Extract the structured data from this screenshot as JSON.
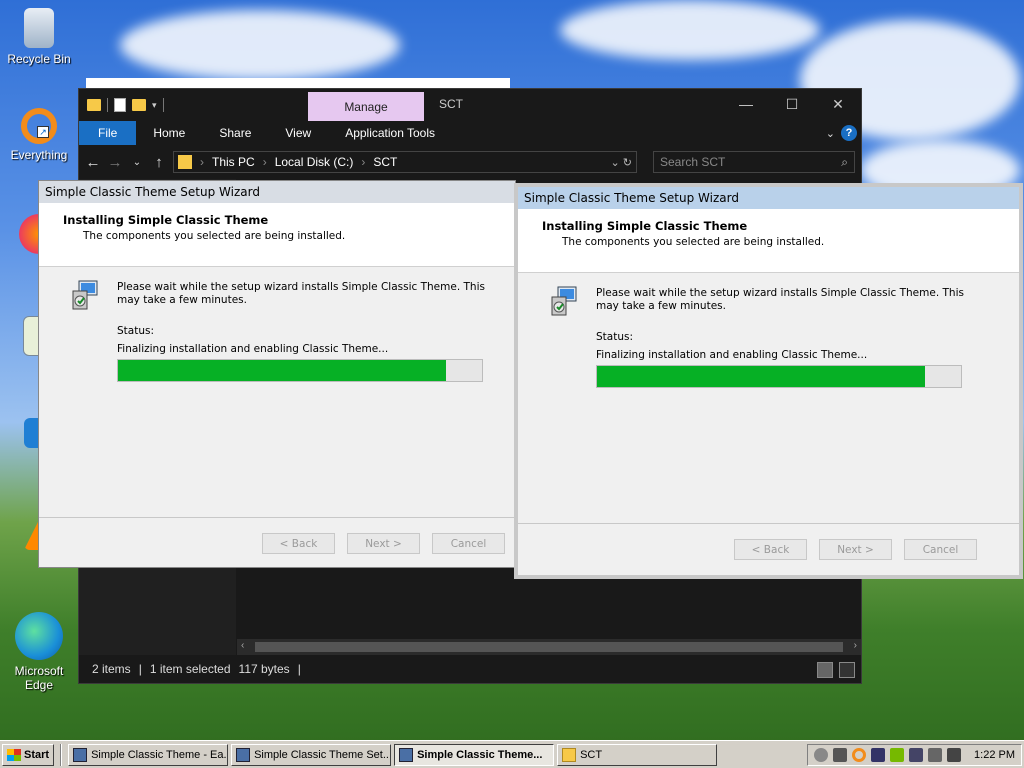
{
  "desktop": {
    "icons": [
      {
        "label": "Recycle Bin"
      },
      {
        "label": "Everything"
      },
      {
        "label": "Firefox"
      },
      {
        "label": "Notepad++"
      },
      {
        "label": "Visual Studio Code"
      },
      {
        "label": "VLC media player"
      },
      {
        "label": "Microsoft Edge"
      }
    ]
  },
  "explorer": {
    "manage_tab": "Manage",
    "title": "SCT",
    "ribbon_tabs": [
      "File",
      "Home",
      "Share",
      "View",
      "Application Tools"
    ],
    "address": [
      "This PC",
      "Local Disk (C:)",
      "SCT"
    ],
    "search_placeholder": "Search SCT",
    "status": {
      "items": "2 items",
      "selected": "1 item selected",
      "size": "117 bytes"
    }
  },
  "wizard_left": {
    "title": "Simple Classic Theme Setup Wizard",
    "heading": "Installing Simple Classic Theme",
    "subheading": "The components you selected are being installed.",
    "message": "Please wait while the setup wizard installs Simple Classic Theme. This may take a few minutes.",
    "status_label": "Status:",
    "status_text": "Finalizing installation and enabling Classic Theme...",
    "progress": 0.9,
    "buttons": {
      "back": "< Back",
      "next": "Next >",
      "cancel": "Cancel"
    }
  },
  "wizard_right": {
    "title": "Simple Classic Theme Setup Wizard",
    "heading": "Installing Simple Classic Theme",
    "subheading": "The components you selected are being installed.",
    "message": "Please wait while the setup wizard installs Simple Classic Theme. This may take a few minutes.",
    "status_label": "Status:",
    "status_text": "Finalizing installation and enabling Classic Theme...",
    "progress": 0.9,
    "buttons": {
      "back": "< Back",
      "next": "Next >",
      "cancel": "Cancel"
    }
  },
  "taskbar": {
    "start": "Start",
    "buttons": [
      {
        "label": "Simple Classic Theme - Ea...",
        "active": false
      },
      {
        "label": "Simple Classic Theme Set...",
        "active": false
      },
      {
        "label": "Simple Classic Theme...",
        "active": true
      },
      {
        "label": "SCT",
        "active": false
      }
    ],
    "clock": "1:22 PM"
  },
  "colors": {
    "progress_fill": "#06b025",
    "explorer_bg": "#191919",
    "file_tab": "#1a6fc4",
    "manage_tab": "#e6c8f0"
  }
}
